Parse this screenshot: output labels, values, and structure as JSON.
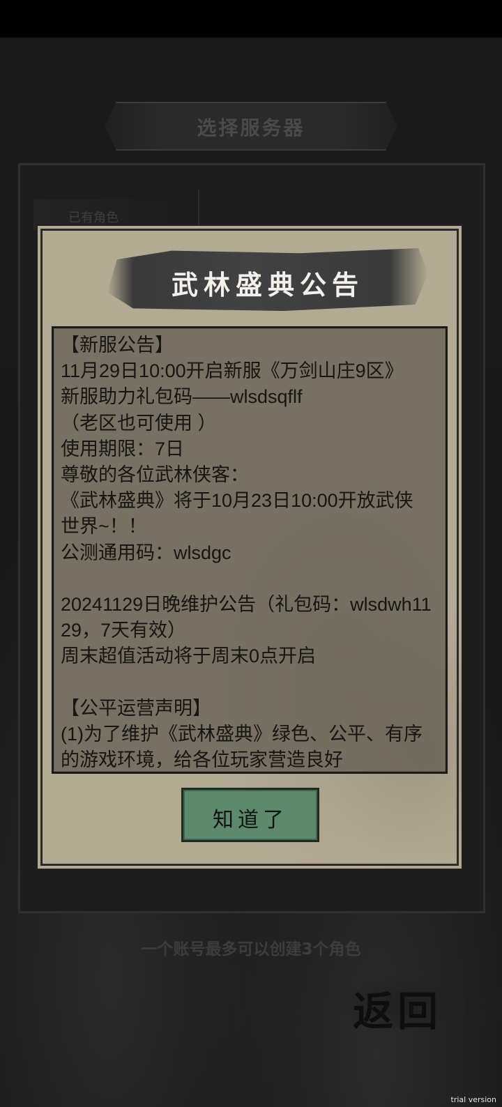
{
  "background": {
    "title": "选择服务器",
    "role_tab": "已有角色",
    "footer_note": "一个账号最多可以创建3个角色",
    "back_label": "返回"
  },
  "dialog": {
    "title": "武林盛典公告",
    "notice": "【新服公告】\n11月29日10:00开启新服《万剑山庄9区》\n新服助力礼包码——wlsdsqflf\n（老区也可使用 ）\n使用期限：7日\n尊敬的各位武林侠客：\n《武林盛典》将于10月23日10:00开放武侠世界~！！\n公测通用码：wlsdgc\n\n20241129日晚维护公告（礼包码：wlsdwh1129，7天有效）\n周末超值活动将于周末0点开启\n\n【公平运营声明】\n(1)为了维护《武林盛典》绿色、公平、有序的游戏环境，给各位玩家营造良好",
    "ok_label": "知道了"
  },
  "watermark": "trial version",
  "colors": {
    "dialog_bg": "#b3aa94",
    "notice_bg": "#5f5a50",
    "ok_button": "#5d8a6c",
    "header_band": "#3a3a3a"
  }
}
